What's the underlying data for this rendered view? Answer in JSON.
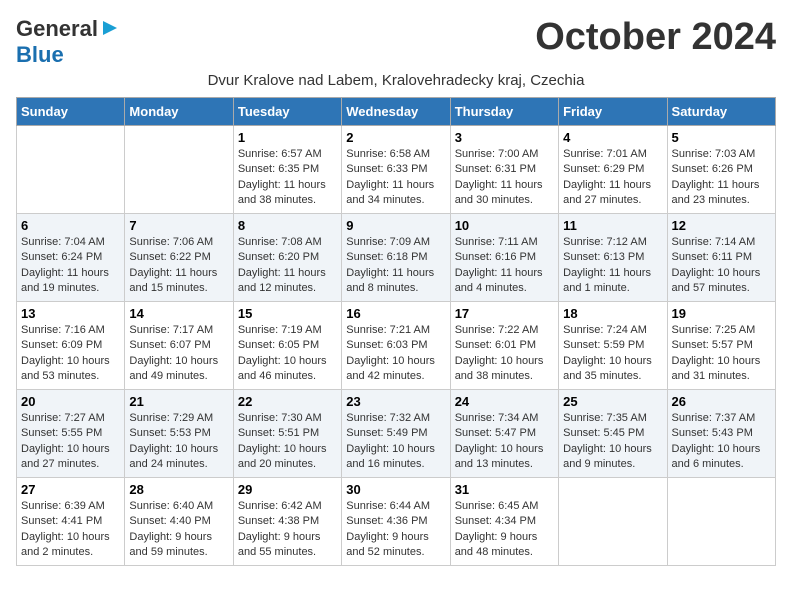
{
  "header": {
    "logo_line1": "General",
    "logo_line2": "Blue",
    "month_title": "October 2024",
    "subtitle": "Dvur Kralove nad Labem, Kralovehradecky kraj, Czechia"
  },
  "days_of_week": [
    "Sunday",
    "Monday",
    "Tuesday",
    "Wednesday",
    "Thursday",
    "Friday",
    "Saturday"
  ],
  "weeks": [
    [
      {
        "day": "",
        "info": ""
      },
      {
        "day": "",
        "info": ""
      },
      {
        "day": "1",
        "sunrise": "6:57 AM",
        "sunset": "6:35 PM",
        "daylight": "11 hours and 38 minutes."
      },
      {
        "day": "2",
        "sunrise": "6:58 AM",
        "sunset": "6:33 PM",
        "daylight": "11 hours and 34 minutes."
      },
      {
        "day": "3",
        "sunrise": "7:00 AM",
        "sunset": "6:31 PM",
        "daylight": "11 hours and 30 minutes."
      },
      {
        "day": "4",
        "sunrise": "7:01 AM",
        "sunset": "6:29 PM",
        "daylight": "11 hours and 27 minutes."
      },
      {
        "day": "5",
        "sunrise": "7:03 AM",
        "sunset": "6:26 PM",
        "daylight": "11 hours and 23 minutes."
      }
    ],
    [
      {
        "day": "6",
        "sunrise": "7:04 AM",
        "sunset": "6:24 PM",
        "daylight": "11 hours and 19 minutes."
      },
      {
        "day": "7",
        "sunrise": "7:06 AM",
        "sunset": "6:22 PM",
        "daylight": "11 hours and 15 minutes."
      },
      {
        "day": "8",
        "sunrise": "7:08 AM",
        "sunset": "6:20 PM",
        "daylight": "11 hours and 12 minutes."
      },
      {
        "day": "9",
        "sunrise": "7:09 AM",
        "sunset": "6:18 PM",
        "daylight": "11 hours and 8 minutes."
      },
      {
        "day": "10",
        "sunrise": "7:11 AM",
        "sunset": "6:16 PM",
        "daylight": "11 hours and 4 minutes."
      },
      {
        "day": "11",
        "sunrise": "7:12 AM",
        "sunset": "6:13 PM",
        "daylight": "11 hours and 1 minute."
      },
      {
        "day": "12",
        "sunrise": "7:14 AM",
        "sunset": "6:11 PM",
        "daylight": "10 hours and 57 minutes."
      }
    ],
    [
      {
        "day": "13",
        "sunrise": "7:16 AM",
        "sunset": "6:09 PM",
        "daylight": "10 hours and 53 minutes."
      },
      {
        "day": "14",
        "sunrise": "7:17 AM",
        "sunset": "6:07 PM",
        "daylight": "10 hours and 49 minutes."
      },
      {
        "day": "15",
        "sunrise": "7:19 AM",
        "sunset": "6:05 PM",
        "daylight": "10 hours and 46 minutes."
      },
      {
        "day": "16",
        "sunrise": "7:21 AM",
        "sunset": "6:03 PM",
        "daylight": "10 hours and 42 minutes."
      },
      {
        "day": "17",
        "sunrise": "7:22 AM",
        "sunset": "6:01 PM",
        "daylight": "10 hours and 38 minutes."
      },
      {
        "day": "18",
        "sunrise": "7:24 AM",
        "sunset": "5:59 PM",
        "daylight": "10 hours and 35 minutes."
      },
      {
        "day": "19",
        "sunrise": "7:25 AM",
        "sunset": "5:57 PM",
        "daylight": "10 hours and 31 minutes."
      }
    ],
    [
      {
        "day": "20",
        "sunrise": "7:27 AM",
        "sunset": "5:55 PM",
        "daylight": "10 hours and 27 minutes."
      },
      {
        "day": "21",
        "sunrise": "7:29 AM",
        "sunset": "5:53 PM",
        "daylight": "10 hours and 24 minutes."
      },
      {
        "day": "22",
        "sunrise": "7:30 AM",
        "sunset": "5:51 PM",
        "daylight": "10 hours and 20 minutes."
      },
      {
        "day": "23",
        "sunrise": "7:32 AM",
        "sunset": "5:49 PM",
        "daylight": "10 hours and 16 minutes."
      },
      {
        "day": "24",
        "sunrise": "7:34 AM",
        "sunset": "5:47 PM",
        "daylight": "10 hours and 13 minutes."
      },
      {
        "day": "25",
        "sunrise": "7:35 AM",
        "sunset": "5:45 PM",
        "daylight": "10 hours and 9 minutes."
      },
      {
        "day": "26",
        "sunrise": "7:37 AM",
        "sunset": "5:43 PM",
        "daylight": "10 hours and 6 minutes."
      }
    ],
    [
      {
        "day": "27",
        "sunrise": "6:39 AM",
        "sunset": "4:41 PM",
        "daylight": "10 hours and 2 minutes."
      },
      {
        "day": "28",
        "sunrise": "6:40 AM",
        "sunset": "4:40 PM",
        "daylight": "9 hours and 59 minutes."
      },
      {
        "day": "29",
        "sunrise": "6:42 AM",
        "sunset": "4:38 PM",
        "daylight": "9 hours and 55 minutes."
      },
      {
        "day": "30",
        "sunrise": "6:44 AM",
        "sunset": "4:36 PM",
        "daylight": "9 hours and 52 minutes."
      },
      {
        "day": "31",
        "sunrise": "6:45 AM",
        "sunset": "4:34 PM",
        "daylight": "9 hours and 48 minutes."
      },
      {
        "day": "",
        "info": ""
      },
      {
        "day": "",
        "info": ""
      }
    ]
  ],
  "labels": {
    "sunrise": "Sunrise:",
    "sunset": "Sunset:",
    "daylight": "Daylight:"
  }
}
